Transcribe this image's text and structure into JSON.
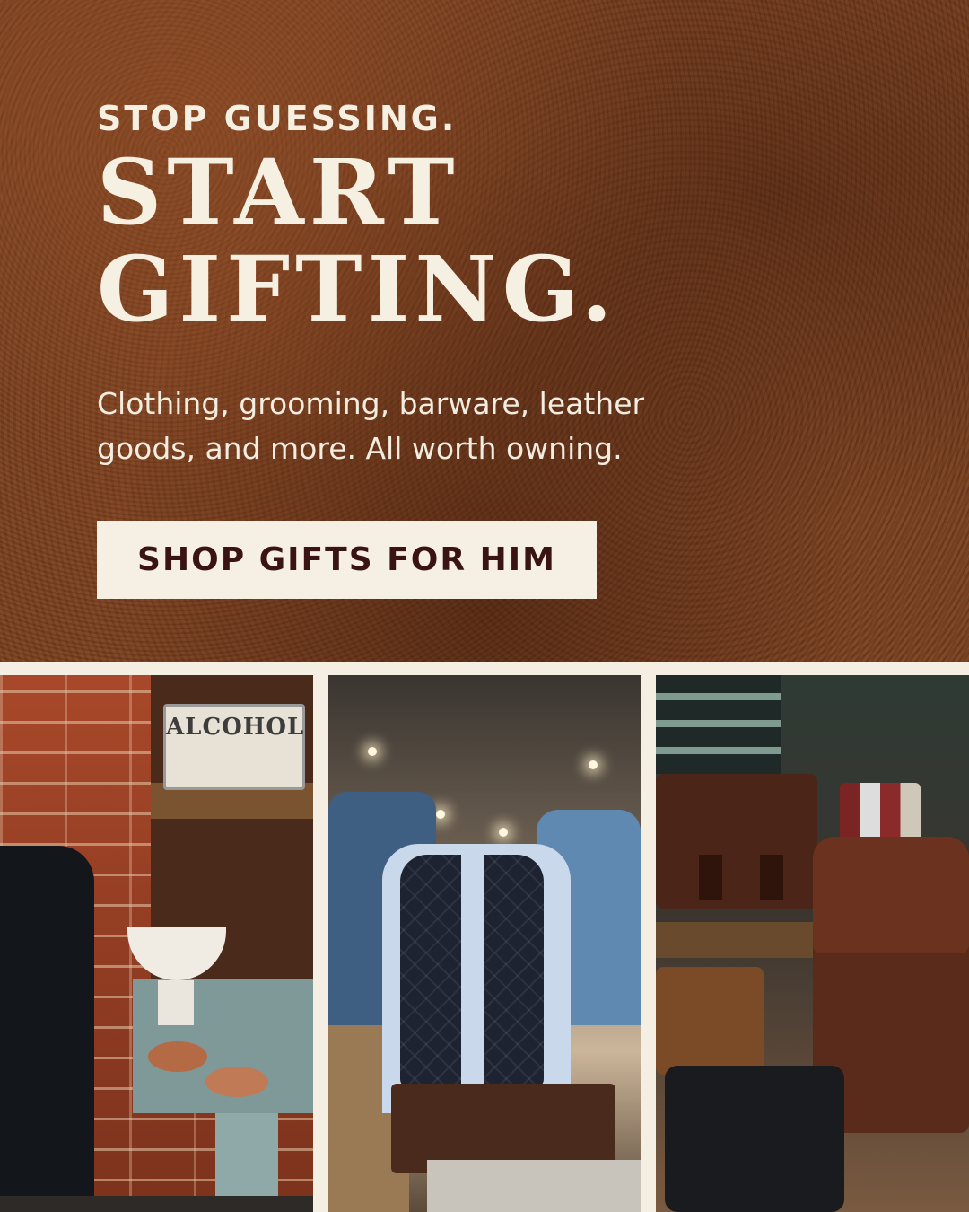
{
  "hero": {
    "kicker": "STOP GUESSING.",
    "headline_line1": "START",
    "headline_line2": "GIFTING.",
    "subtext": "Clothing, grooming, barware, leather goods, and more. All worth owning.",
    "cta_label": "SHOP GIFTS FOR HIM"
  },
  "photos": {
    "photo1": {
      "sign_text": "ALCOHOL"
    }
  },
  "colors": {
    "leather": "#7a3f1e",
    "cream": "#f6f0e4",
    "cta_text": "#3a1414"
  }
}
